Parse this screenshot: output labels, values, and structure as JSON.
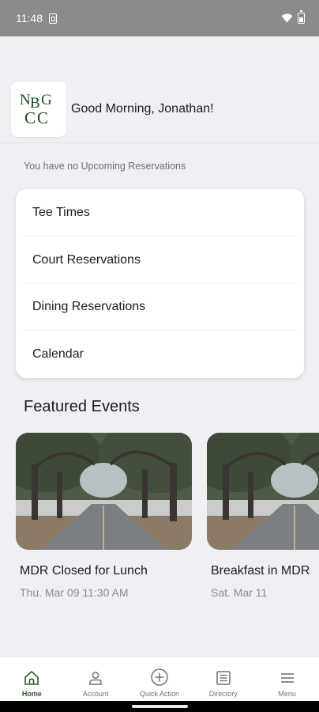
{
  "status_bar": {
    "time": "11:48"
  },
  "header": {
    "logo_text": "NBGCC",
    "greeting": "Good Morning, Jonathan!"
  },
  "reservations_notice": "You have no Upcoming Reservations",
  "quick_links": [
    {
      "label": "Tee Times"
    },
    {
      "label": "Court Reservations"
    },
    {
      "label": "Dining Reservations"
    },
    {
      "label": "Calendar"
    }
  ],
  "featured": {
    "title": "Featured Events",
    "events": [
      {
        "title": "MDR Closed for Lunch",
        "date": "Thu. Mar 09 11:30 AM"
      },
      {
        "title": "Breakfast in MDR",
        "date": "Sat. Mar 11"
      }
    ]
  },
  "tabs": [
    {
      "label": "Home",
      "icon": "home-icon",
      "active": true
    },
    {
      "label": "Account",
      "icon": "person-icon",
      "active": false
    },
    {
      "label": "Quick Action",
      "icon": "plus-circle-icon",
      "active": false
    },
    {
      "label": "Directory",
      "icon": "list-icon",
      "active": false
    },
    {
      "label": "Menu",
      "icon": "hamburger-icon",
      "active": false
    }
  ],
  "colors": {
    "brand_green": "#2f5a2a",
    "logo_green": "#1e4a1c",
    "background": "#eef0f3",
    "status_bar": "#8b8b8b"
  }
}
